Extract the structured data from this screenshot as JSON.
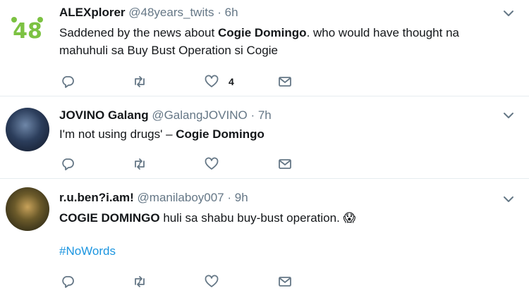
{
  "tweets": [
    {
      "name": "ALEXplorer",
      "handle": "@48years_twits",
      "dot": "·",
      "time": "6h",
      "text_prefix": "Saddened by the news about ",
      "text_bold": "Cogie Domingo",
      "text_suffix": ". who would have thought na mahuhuli sa Buy Bust Operation si Cogie",
      "like_count": "4",
      "avatar_text": "48"
    },
    {
      "name": "JOVINO Galang",
      "handle": "@GalangJOVINO",
      "dot": "·",
      "time": "7h",
      "text_prefix": "I'm not using drugs' – ",
      "text_bold": "Cogie Domingo",
      "text_suffix": ""
    },
    {
      "name": "r.u.ben?i.am!",
      "handle": "@manilaboy007",
      "dot": "·",
      "time": "9h",
      "text_bold": "COGIE DOMINGO",
      "text_suffix": " huli sa shabu buy-bust operation. ",
      "emoji": "😱",
      "hashtag": "#NoWords"
    }
  ],
  "icons": [
    "reply-icon",
    "retweet-icon",
    "like-icon",
    "direct-message-icon",
    "caret-down-icon"
  ],
  "colors": {
    "text": "#14171a",
    "secondary": "#657786",
    "hashtag": "#1b95e0",
    "icon": "#657786",
    "avatar_logo": "#7cc242"
  }
}
